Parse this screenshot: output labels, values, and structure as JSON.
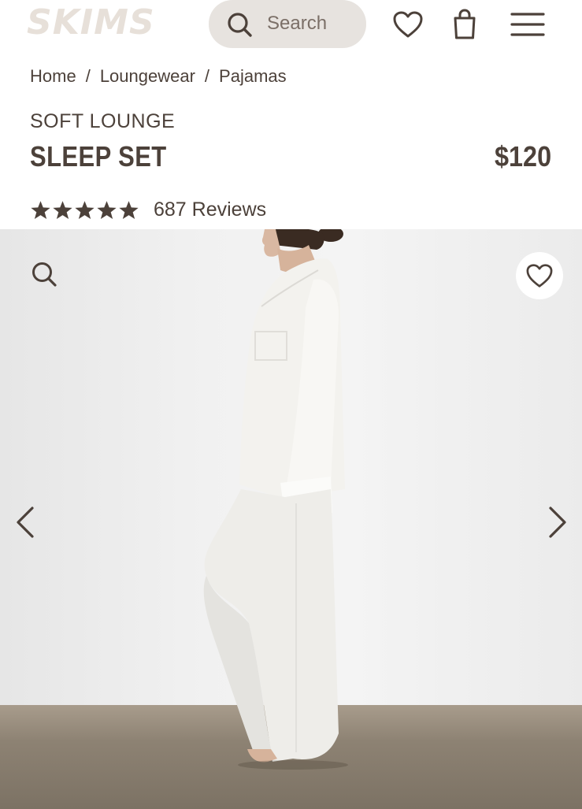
{
  "brand": {
    "logo_text": "SKIMS"
  },
  "header": {
    "search_placeholder": "Search",
    "icons": [
      "search-icon",
      "heart-icon",
      "shopping-bag-icon",
      "hamburger-menu-icon"
    ]
  },
  "breadcrumb": {
    "items": [
      "Home",
      "Loungewear",
      "Pajamas"
    ],
    "separator": "/"
  },
  "product": {
    "collection": "SOFT LOUNGE",
    "name": "SLEEP SET",
    "price": "$120",
    "rating": 5,
    "reviews_label": "687 Reviews"
  },
  "gallery": {
    "icons": [
      "zoom-search-icon",
      "wishlist-heart-icon",
      "chevron-left-icon",
      "chevron-right-icon"
    ]
  },
  "colors": {
    "text": "#4c413a",
    "search_bg": "#e7e3df",
    "logo": "#e7e0d9"
  }
}
